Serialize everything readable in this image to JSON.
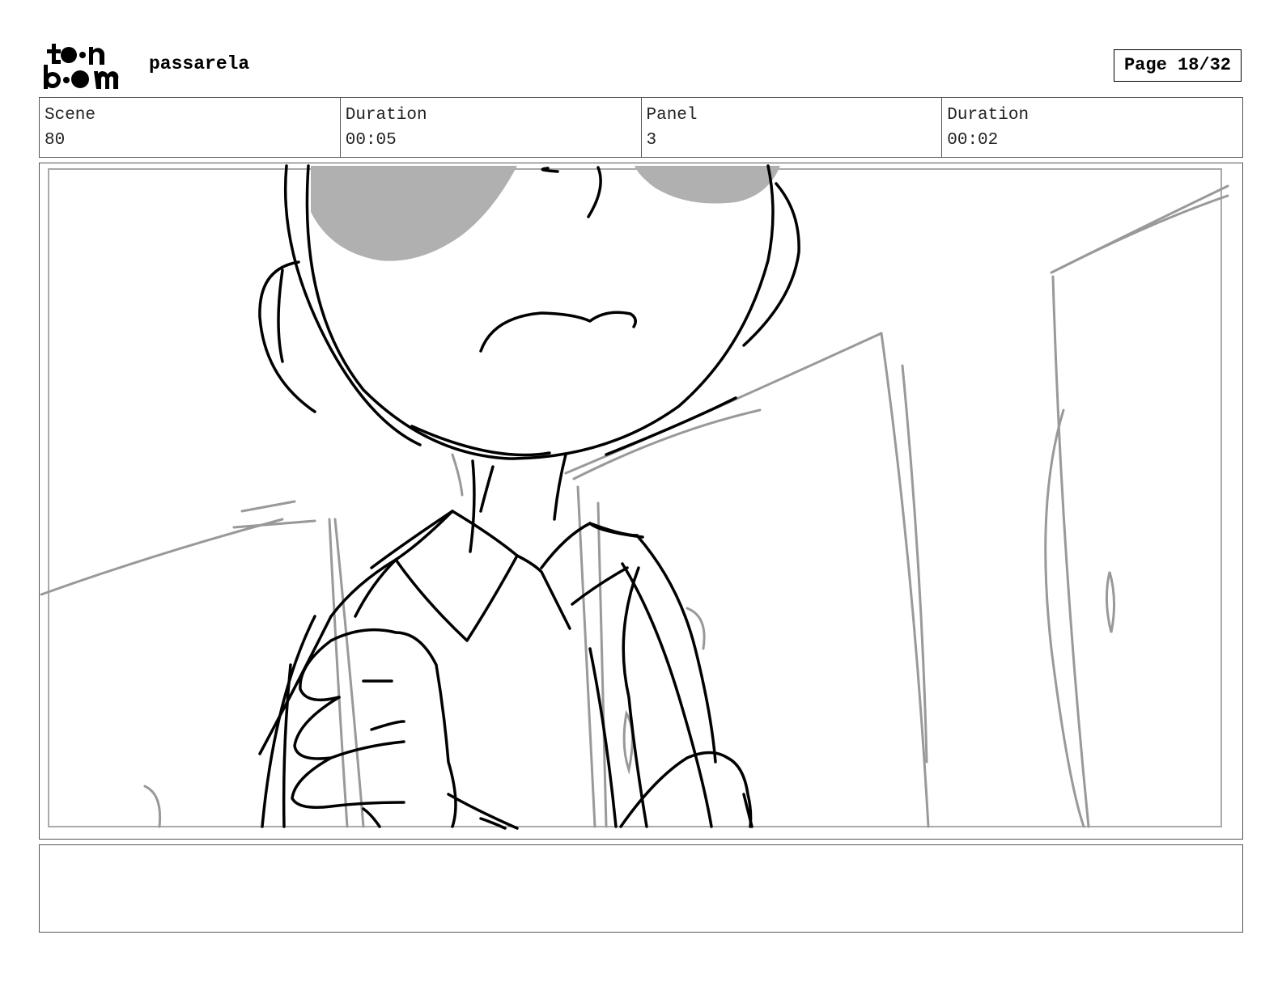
{
  "header": {
    "project_title": "passarela",
    "page_indicator": "Page 18/32",
    "logo": {
      "line1": "toon",
      "line2": "boom"
    }
  },
  "info": {
    "scene_label": "Scene",
    "scene_value": "80",
    "duration_label": "Duration",
    "duration_value": "00:05",
    "panel_label": "Panel",
    "panel_value": "3",
    "panel_duration_label": "Duration",
    "panel_duration_value": "00:02"
  },
  "panel": {
    "sketch_icon": "storyboard-sketch",
    "line_color": "#000000",
    "rough_color": "#999999",
    "shadow_color": "#b0b0b0"
  },
  "notes": {
    "text": ""
  }
}
